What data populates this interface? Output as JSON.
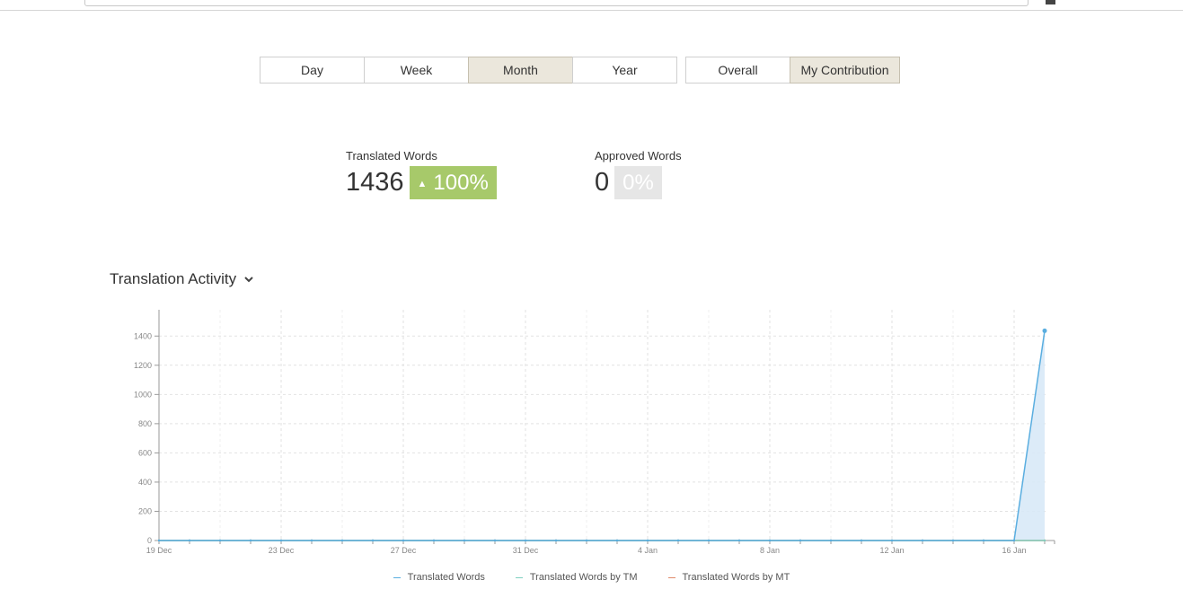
{
  "period_tabs": [
    {
      "label": "Day",
      "active": false
    },
    {
      "label": "Week",
      "active": false
    },
    {
      "label": "Month",
      "active": true
    },
    {
      "label": "Year",
      "active": false
    }
  ],
  "scope_tabs": [
    {
      "label": "Overall",
      "active": false
    },
    {
      "label": "My Contribution",
      "active": true
    }
  ],
  "stats": {
    "translated": {
      "label": "Translated Words",
      "value": "1436",
      "change": "100%",
      "trend": "up"
    },
    "approved": {
      "label": "Approved Words",
      "value": "0",
      "change": "0%",
      "trend": "flat"
    }
  },
  "activity": {
    "title": "Translation Activity",
    "toggle_icon": "chevron-down-icon"
  },
  "colors": {
    "translated": "#5aaee0",
    "tm": "#7fd0c0",
    "mt": "#e08a6a",
    "up": "#a7c96a",
    "active_tab": "#ebe7dc"
  },
  "chart_data": {
    "type": "area",
    "x_tick_labels": [
      "19 Dec",
      "23 Dec",
      "27 Dec",
      "31 Dec",
      "4 Jan",
      "8 Jan",
      "12 Jan",
      "16 Jan"
    ],
    "x": [
      "19 Dec",
      "20 Dec",
      "21 Dec",
      "22 Dec",
      "23 Dec",
      "24 Dec",
      "25 Dec",
      "26 Dec",
      "27 Dec",
      "28 Dec",
      "29 Dec",
      "30 Dec",
      "31 Dec",
      "1 Jan",
      "2 Jan",
      "3 Jan",
      "4 Jan",
      "5 Jan",
      "6 Jan",
      "7 Jan",
      "8 Jan",
      "9 Jan",
      "10 Jan",
      "11 Jan",
      "12 Jan",
      "13 Jan",
      "14 Jan",
      "15 Jan",
      "16 Jan",
      "17 Jan"
    ],
    "y_ticks": [
      0,
      200,
      400,
      600,
      800,
      1000,
      1200,
      1400
    ],
    "ylim": [
      0,
      1580
    ],
    "grid": true,
    "legend_position": "bottom",
    "series": [
      {
        "name": "Translated Words",
        "values": [
          0,
          0,
          0,
          0,
          0,
          0,
          0,
          0,
          0,
          0,
          0,
          0,
          0,
          0,
          0,
          0,
          0,
          0,
          0,
          0,
          0,
          0,
          0,
          0,
          0,
          0,
          0,
          0,
          0,
          1436
        ]
      },
      {
        "name": "Translated Words by TM",
        "values": [
          0,
          0,
          0,
          0,
          0,
          0,
          0,
          0,
          0,
          0,
          0,
          0,
          0,
          0,
          0,
          0,
          0,
          0,
          0,
          0,
          0,
          0,
          0,
          0,
          0,
          0,
          0,
          0,
          0,
          0
        ]
      },
      {
        "name": "Translated Words by MT",
        "values": [
          0,
          0,
          0,
          0,
          0,
          0,
          0,
          0,
          0,
          0,
          0,
          0,
          0,
          0,
          0,
          0,
          0,
          0,
          0,
          0,
          0,
          0,
          0,
          0,
          0,
          0,
          0,
          0,
          0,
          0
        ]
      }
    ]
  }
}
